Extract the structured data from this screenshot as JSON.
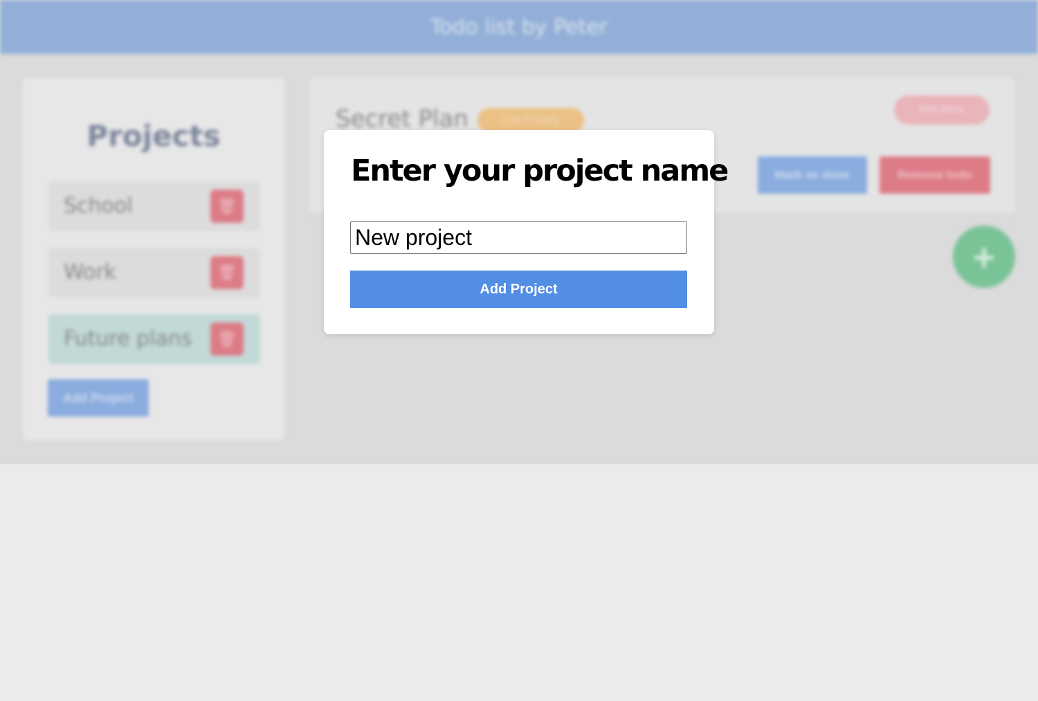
{
  "header": {
    "title": "Todo list by Peter"
  },
  "sidebar": {
    "title": "Projects",
    "projects": [
      {
        "label": "School",
        "active": false
      },
      {
        "label": "Work",
        "active": false
      },
      {
        "label": "Future plans",
        "active": true
      }
    ],
    "add_button_label": "Add Project"
  },
  "todo": {
    "title": "Secret Plan",
    "tag": "Low Priority",
    "status": "Not done",
    "mark_done_label": "Mark as done",
    "remove_label": "Remove todo"
  },
  "fab": {
    "icon": "plus-icon",
    "symbol": "+"
  },
  "modal": {
    "title": "Enter your project name",
    "input_value": "New project",
    "submit_label": "Add Project"
  },
  "colors": {
    "header": "#96b3dd",
    "primary_button": "#518ee4",
    "danger": "#e27f8a",
    "fab": "#7cc79a",
    "active_project": "#c6dedd"
  }
}
